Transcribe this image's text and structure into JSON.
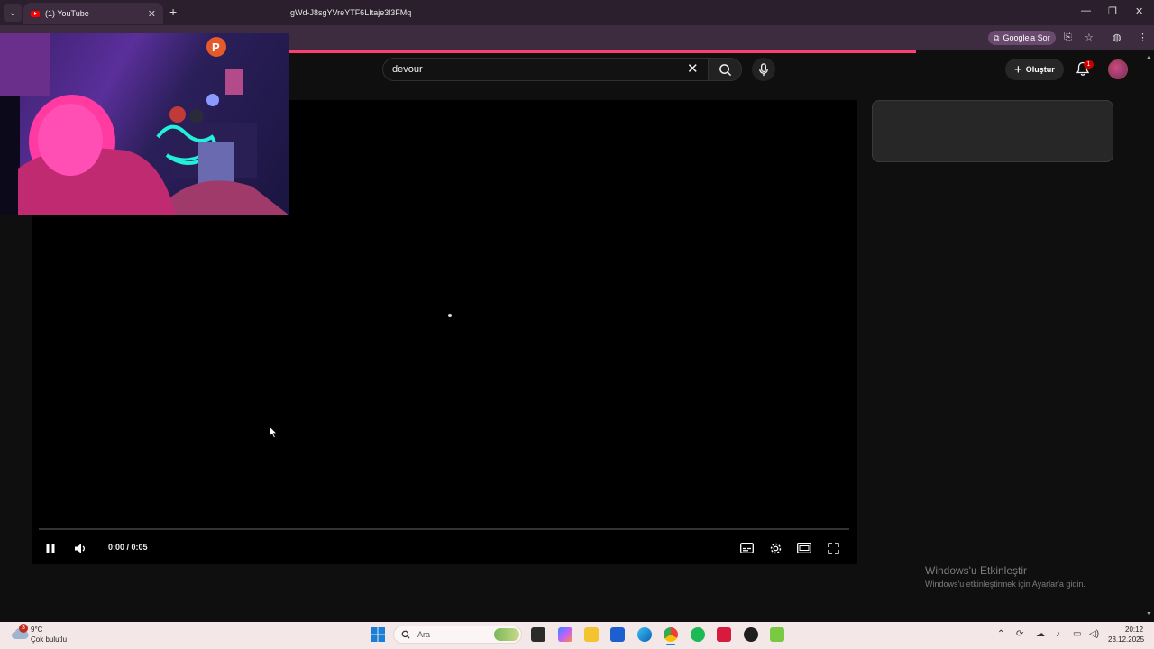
{
  "browser": {
    "tab_title": "(1) YouTube",
    "url_visible": "gWd-J8sgYVreYTF6LItaje3l3FMq",
    "ask_google_label": "Google'a Sor"
  },
  "youtube": {
    "search_value": "devour",
    "create_label": "Oluştur",
    "notification_count": "1"
  },
  "player": {
    "time_display": "0:00 / 0:05",
    "progress_fraction": 0.0
  },
  "watermark": {
    "title": "Windows'u Etkinleştir",
    "subtitle": "Windows'u etkinleştirmek için Ayarlar'a gidin."
  },
  "taskbar": {
    "weather_badge": "3",
    "temperature": "9°C",
    "condition": "Çok bulutlu",
    "search_placeholder": "Ara",
    "time": "20:12",
    "date": "23.12.2025"
  },
  "colors": {
    "brand_red": "#ff0000",
    "browser_frame": "#3d2b40",
    "loading_bar": "#ff3d6e",
    "taskbar": "#f3e7e7"
  }
}
